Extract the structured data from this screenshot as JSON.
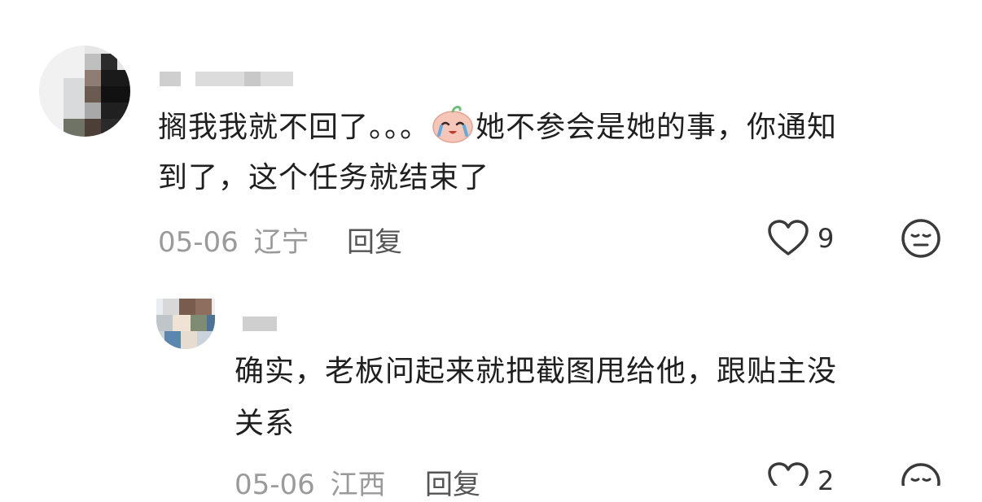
{
  "comments": [
    {
      "text_line1": "搁我我就不回了。。。",
      "emoji": "crying-face-emoji",
      "text_line1b": "她不参会是她的事，你通知",
      "text_line2": "到了，这个任务就结束了",
      "date": "05-06",
      "location": "辽宁",
      "reply_label": "回复",
      "likes": "9"
    },
    {
      "text_line1": "确实，老板问起来就把截图甩给他，跟贴主没",
      "text_line2": "关系",
      "date": "05-06",
      "location": "江西",
      "reply_label": "回复",
      "likes": "2"
    }
  ]
}
